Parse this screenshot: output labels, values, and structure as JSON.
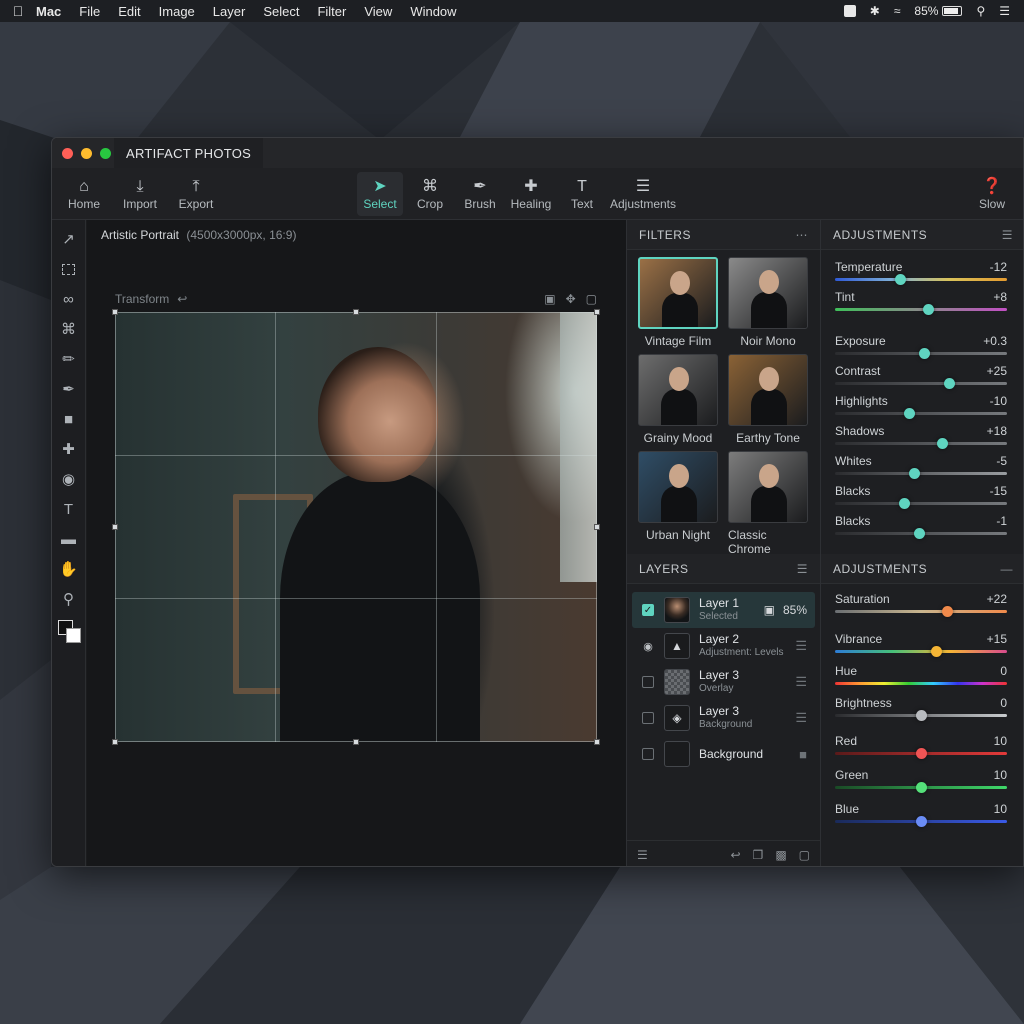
{
  "menubar": {
    "app_name": "Mac",
    "items": [
      "File",
      "Edit",
      "Image",
      "Layer",
      "Select",
      "Filter",
      "View",
      "Window"
    ],
    "battery_percent": "85%",
    "battery_level": 0.85
  },
  "window": {
    "title": "ARTIFACT PHOTOS"
  },
  "toolbar": {
    "home": "Home",
    "import": "Import",
    "export": "Export",
    "select": "Select",
    "crop": "Crop",
    "brush": "Brush",
    "healing": "Healing",
    "text": "Text",
    "adjustments": "Adjustments",
    "help": "Slow"
  },
  "document": {
    "name": "Artistic Portrait",
    "meta": "(4500x3000px, 16:9)",
    "transform_label": "Transform"
  },
  "filters": {
    "header": "FILTERS",
    "items": [
      {
        "label": "Vintage Film",
        "selected": true,
        "tone": "#9a7046"
      },
      {
        "label": "Noir Mono",
        "selected": false,
        "tone": "#8a8a8a"
      },
      {
        "label": "Grainy Mood",
        "selected": false,
        "tone": "#6d6d6d"
      },
      {
        "label": "Earthy Tone",
        "selected": false,
        "tone": "#8a6236"
      },
      {
        "label": "Urban Night",
        "selected": false,
        "tone": "#2f4d66"
      },
      {
        "label": "Classic Chrome",
        "selected": false,
        "tone": "#7c7c7c"
      }
    ]
  },
  "adjustments_top": {
    "header": "ADJUSTMENTS",
    "rows": [
      {
        "label": "Temperature",
        "value": "-12",
        "pos": 0.38,
        "knob": "#5fd4c0",
        "track": "linear-gradient(90deg,#2f5ad6,#7fb0d8,#d9c25a,#e39a2f)"
      },
      {
        "label": "Tint",
        "value": "+8",
        "pos": 0.54,
        "knob": "#5fd4c0",
        "track": "linear-gradient(90deg,#3fbf5a,#8a8a8a,#c24fc4)"
      },
      {
        "label": "Exposure",
        "value": "+0.3",
        "pos": 0.52,
        "knob": "#5fd4c0",
        "track": "linear-gradient(90deg,#2a2b2e,#777a7e)"
      },
      {
        "label": "Contrast",
        "value": "+25",
        "pos": 0.66,
        "knob": "#5fd4c0",
        "track": "linear-gradient(90deg,#2a2b2e,#777a7e)"
      },
      {
        "label": "Highlights",
        "value": "-10",
        "pos": 0.43,
        "knob": "#5fd4c0",
        "track": "linear-gradient(90deg,#2a2b2e,#777a7e)"
      },
      {
        "label": "Shadows",
        "value": "+18",
        "pos": 0.62,
        "knob": "#5fd4c0",
        "track": "linear-gradient(90deg,#2a2b2e,#777a7e)"
      },
      {
        "label": "Whites",
        "value": "-5",
        "pos": 0.46,
        "knob": "#5fd4c0",
        "track": "linear-gradient(90deg,#2a2b2e,#9a9da1)"
      },
      {
        "label": "Blacks",
        "value": "-15",
        "pos": 0.4,
        "knob": "#5fd4c0",
        "track": "linear-gradient(90deg,#2a2b2e,#777a7e)"
      },
      {
        "label": "Blacks",
        "value": "-1",
        "pos": 0.49,
        "knob": "#5fd4c0",
        "track": "linear-gradient(90deg,#2a2b2e,#777a7e)"
      }
    ]
  },
  "layers": {
    "header": "LAYERS",
    "items": [
      {
        "name": "Layer 1",
        "sub": "Selected",
        "state": "checked",
        "thumb": "photo",
        "opacity": "85%",
        "selected": true
      },
      {
        "name": "Layer 2",
        "sub": "Adjustment: Levels",
        "state": "eye",
        "thumb": "levels",
        "selected": false
      },
      {
        "name": "Layer 3",
        "sub": "Overlay",
        "state": "unchecked",
        "thumb": "checker",
        "selected": false
      },
      {
        "name": "Layer 3",
        "sub": "Background",
        "state": "unchecked",
        "thumb": "stack",
        "selected": false
      },
      {
        "name": "Background",
        "sub": "",
        "state": "unchecked",
        "thumb": "blank",
        "selected": false,
        "locked": true
      }
    ]
  },
  "adjustments_bottom": {
    "header": "ADJUSTMENTS",
    "rows": [
      {
        "label": "Saturation",
        "value": "+22",
        "pos": 0.65,
        "knob": "#f08a4b",
        "track": "linear-gradient(90deg,#6b6f73,#c9b58e,#f08a4b)"
      },
      {
        "label": "Vibrance",
        "value": "+15",
        "pos": 0.59,
        "knob": "#f5b535",
        "track": "linear-gradient(90deg,#2d7cd6,#46c07a,#f5b535,#d84b8e)"
      },
      {
        "label": "Hue",
        "value": "0",
        "pos": 0.5,
        "knob": "",
        "track": "linear-gradient(90deg,#e33,#f93,#ee3,#3c3,#3cf,#33e,#c3c,#e33)"
      },
      {
        "label": "Brightness",
        "value": "0",
        "pos": 0.5,
        "knob": "#b8bbbf",
        "track": "linear-gradient(90deg,#2a2b2e,#c9cccf)"
      },
      {
        "label": "Red",
        "value": "10",
        "pos": 0.5,
        "knob": "#f05555",
        "track": "linear-gradient(90deg,#5a1a1a,#e33a3a)"
      },
      {
        "label": "Green",
        "value": "10",
        "pos": 0.5,
        "knob": "#55e07a",
        "track": "linear-gradient(90deg,#1a4a26,#3fd86a)"
      },
      {
        "label": "Blue",
        "value": "10",
        "pos": 0.5,
        "knob": "#6a8cf5",
        "track": "linear-gradient(90deg,#1a2a5a,#3a5ae8)"
      }
    ]
  },
  "colors": {
    "accent": "#5fd4c0"
  }
}
